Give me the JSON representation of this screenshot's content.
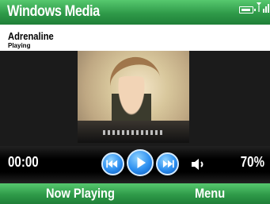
{
  "titlebar": {
    "title": "Windows Media",
    "icons": [
      "battery-icon",
      "signal-strength-icon"
    ]
  },
  "now_playing": {
    "track_title": "Adrenaline",
    "state": "Playing"
  },
  "controls": {
    "elapsed": "00:00",
    "volume_percent": "70%",
    "buttons": [
      "previous-track",
      "play",
      "next-track",
      "volume"
    ]
  },
  "softkeys": {
    "left": "Now Playing",
    "right": "Menu"
  },
  "colors": {
    "bar_green": "#2f9a49",
    "button_blue": "#2d8ff0",
    "controls_bg": "#000000"
  }
}
